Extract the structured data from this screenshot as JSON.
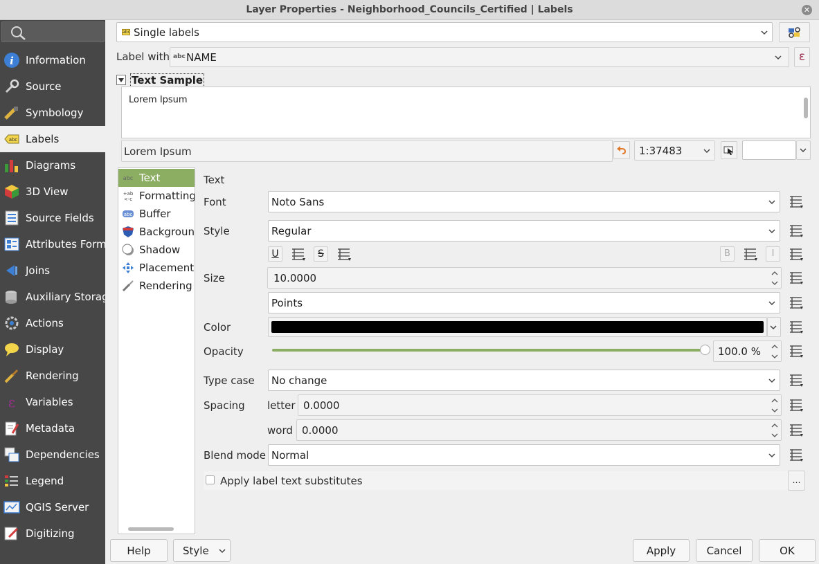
{
  "window": {
    "title": "Layer Properties - Neighborhood_Councils_Certified | Labels",
    "close_glyph": "✕"
  },
  "sidebar": {
    "search_icon": "search-icon",
    "items": [
      {
        "label": "Information",
        "icon": "information-icon"
      },
      {
        "label": "Source",
        "icon": "source-icon"
      },
      {
        "label": "Symbology",
        "icon": "symbology-icon"
      },
      {
        "label": "Labels",
        "icon": "labels-icon"
      },
      {
        "label": "Diagrams",
        "icon": "diagrams-icon"
      },
      {
        "label": "3D View",
        "icon": "3d-view-icon"
      },
      {
        "label": "Source Fields",
        "icon": "source-fields-icon"
      },
      {
        "label": "Attributes Form",
        "icon": "attributes-form-icon"
      },
      {
        "label": "Joins",
        "icon": "joins-icon"
      },
      {
        "label": "Auxiliary Storage",
        "icon": "auxiliary-storage-icon"
      },
      {
        "label": "Actions",
        "icon": "actions-icon"
      },
      {
        "label": "Display",
        "icon": "display-icon"
      },
      {
        "label": "Rendering",
        "icon": "rendering-icon"
      },
      {
        "label": "Variables",
        "icon": "variables-icon"
      },
      {
        "label": "Metadata",
        "icon": "metadata-icon"
      },
      {
        "label": "Dependencies",
        "icon": "dependencies-icon"
      },
      {
        "label": "Legend",
        "icon": "legend-icon"
      },
      {
        "label": "QGIS Server",
        "icon": "qgis-server-icon"
      },
      {
        "label": "Digitizing",
        "icon": "digitizing-icon"
      }
    ]
  },
  "mode": {
    "value": "Single labels",
    "icon_text": "abc"
  },
  "label_with": {
    "label": "Label with",
    "value": "NAME",
    "icon_text": "abc",
    "expression_glyph": "ε"
  },
  "text_sample": {
    "header": "Text Sample",
    "preview": "Lorem Ipsum",
    "input": "Lorem Ipsum",
    "scale": "1:37483",
    "extra": ""
  },
  "tabs": [
    {
      "label": "Text",
      "icon": "text-tab-icon"
    },
    {
      "label": "Formatting",
      "icon": "formatting-tab-icon"
    },
    {
      "label": "Buffer",
      "icon": "buffer-tab-icon"
    },
    {
      "label": "Background",
      "icon": "background-tab-icon"
    },
    {
      "label": "Shadow",
      "icon": "shadow-tab-icon"
    },
    {
      "label": "Placement",
      "icon": "placement-tab-icon"
    },
    {
      "label": "Rendering",
      "icon": "rendering-tab-icon"
    }
  ],
  "text_panel": {
    "heading": "Text",
    "font_label": "Font",
    "font": "Noto Sans",
    "style_label": "Style",
    "style": "Regular",
    "underline": "U",
    "strike": "S",
    "bold": "B",
    "italic": "I",
    "size_label": "Size",
    "size": "10.0000",
    "units": "Points",
    "color_label": "Color",
    "color": "#000000",
    "opacity_label": "Opacity",
    "opacity": "100.0 %",
    "opacity_fraction": 1.0,
    "typecase_label": "Type case",
    "typecase": "No change",
    "spacing_label": "Spacing",
    "letter_label": "letter",
    "letter": "0.0000",
    "word_label": "word",
    "word": "0.0000",
    "blend_label": "Blend mode",
    "blend": "Normal",
    "substitutes_label": "Apply label text substitutes",
    "substitutes_button": "…"
  },
  "footer": {
    "help": "Help",
    "style": "Style",
    "apply": "Apply",
    "cancel": "Cancel",
    "ok": "OK"
  },
  "colors": {
    "sidebar_bg": "#474747",
    "accent": "#8cae63",
    "selected_bg": "#efefef"
  }
}
